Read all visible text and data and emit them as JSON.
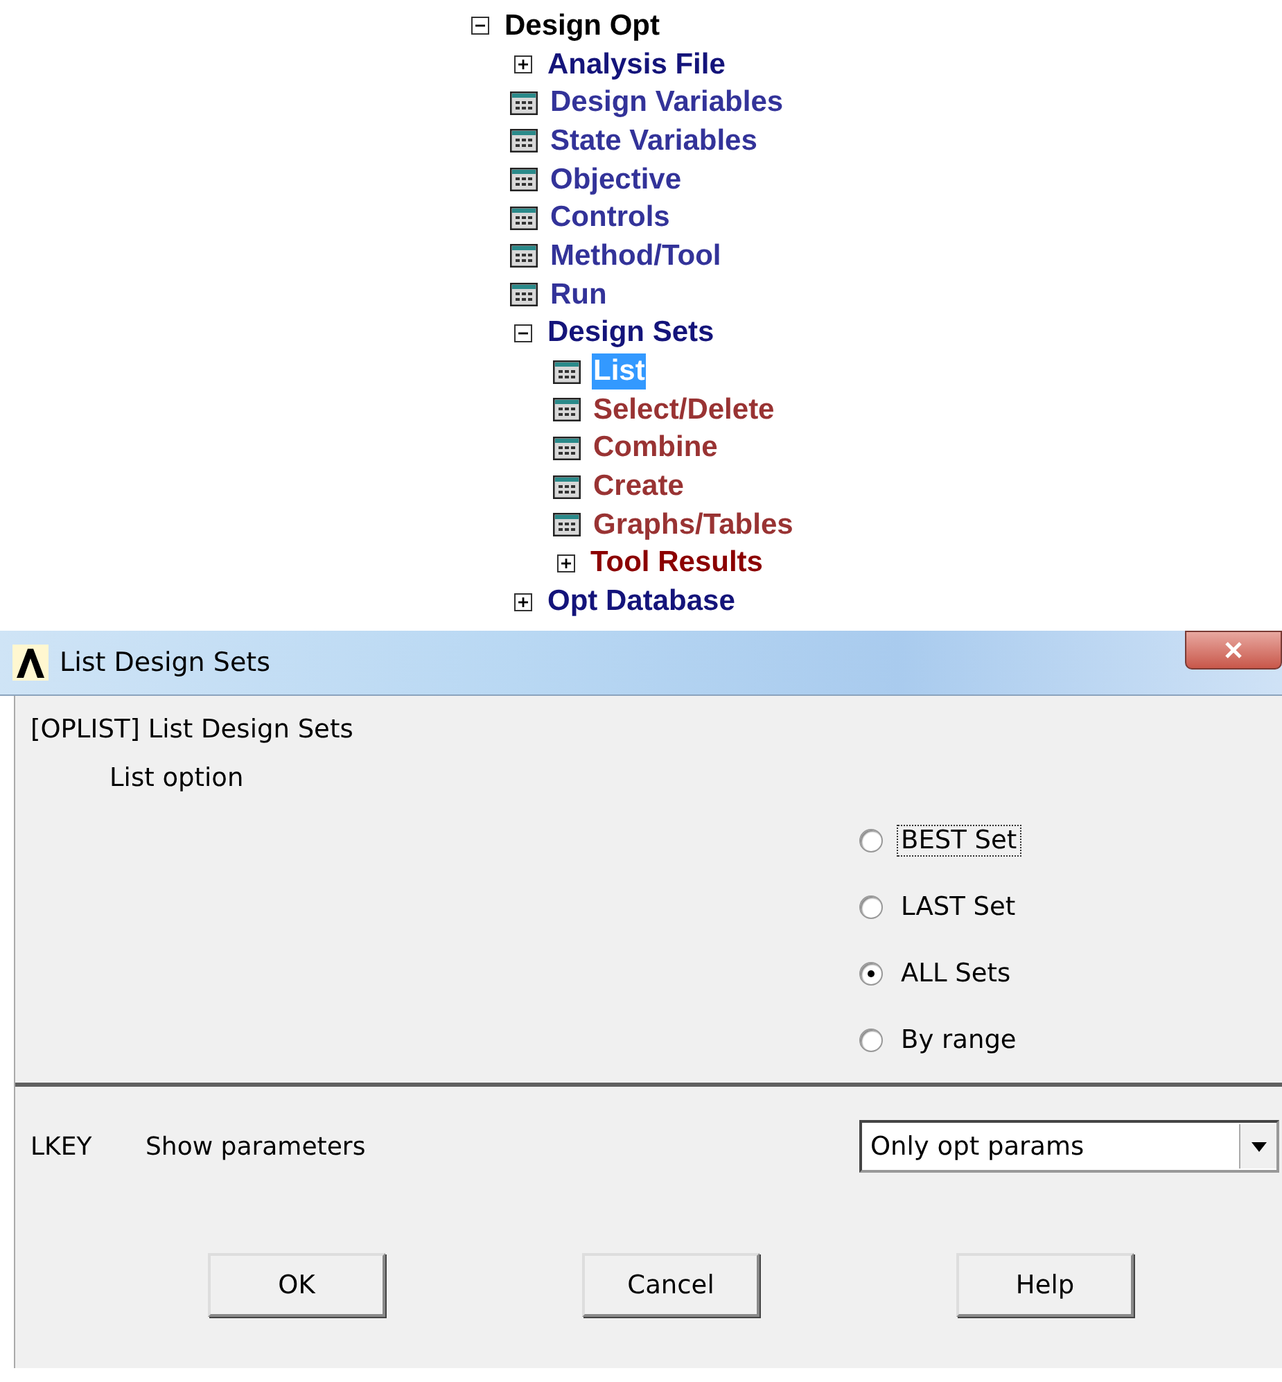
{
  "tree": {
    "label": "Design Opt",
    "kind": "folder",
    "expanded": true,
    "color": "#000000",
    "selected": false,
    "children": [
      {
        "label": "Analysis File",
        "kind": "folder",
        "expanded": false,
        "color": "#14147a",
        "selected": false
      },
      {
        "label": "Design Variables",
        "kind": "leaf",
        "color": "#333399",
        "selected": false
      },
      {
        "label": "State Variables",
        "kind": "leaf",
        "color": "#333399",
        "selected": false
      },
      {
        "label": "Objective",
        "kind": "leaf",
        "color": "#333399",
        "selected": false
      },
      {
        "label": "Controls",
        "kind": "leaf",
        "color": "#333399",
        "selected": false
      },
      {
        "label": "Method/Tool",
        "kind": "leaf",
        "color": "#333399",
        "selected": false
      },
      {
        "label": "Run",
        "kind": "leaf",
        "color": "#333399",
        "selected": false
      },
      {
        "label": "Design Sets",
        "kind": "folder",
        "expanded": true,
        "color": "#14147a",
        "selected": false,
        "children": [
          {
            "label": "List",
            "kind": "leaf",
            "selected": true
          },
          {
            "label": "Select/Delete",
            "kind": "leaf",
            "color": "#993333",
            "selected": false
          },
          {
            "label": "Combine",
            "kind": "leaf",
            "color": "#993333",
            "selected": false
          },
          {
            "label": "Create",
            "kind": "leaf",
            "color": "#993333",
            "selected": false
          },
          {
            "label": "Graphs/Tables",
            "kind": "leaf",
            "color": "#993333",
            "selected": false
          },
          {
            "label": "Tool Results",
            "kind": "folder",
            "expanded": false,
            "color": "#8b0000",
            "selected": false
          }
        ]
      },
      {
        "label": "Opt Database",
        "kind": "folder",
        "expanded": false,
        "color": "#14147a",
        "selected": false
      }
    ]
  },
  "dialog": {
    "title": "List Design Sets",
    "command": "[OPLIST]  List Design Sets",
    "option_label": "List option",
    "options": [
      {
        "label": "BEST Set",
        "selected": false,
        "focused": true
      },
      {
        "label": "LAST Set",
        "selected": false,
        "focused": false
      },
      {
        "label": "ALL Sets",
        "selected": true,
        "focused": false
      },
      {
        "label": "By range",
        "selected": false,
        "focused": false
      }
    ],
    "lkey": "LKEY",
    "lkey_label": "Show parameters",
    "dropdown": {
      "value": "Only opt params"
    },
    "buttons": [
      "OK",
      "Cancel",
      "Help"
    ]
  }
}
